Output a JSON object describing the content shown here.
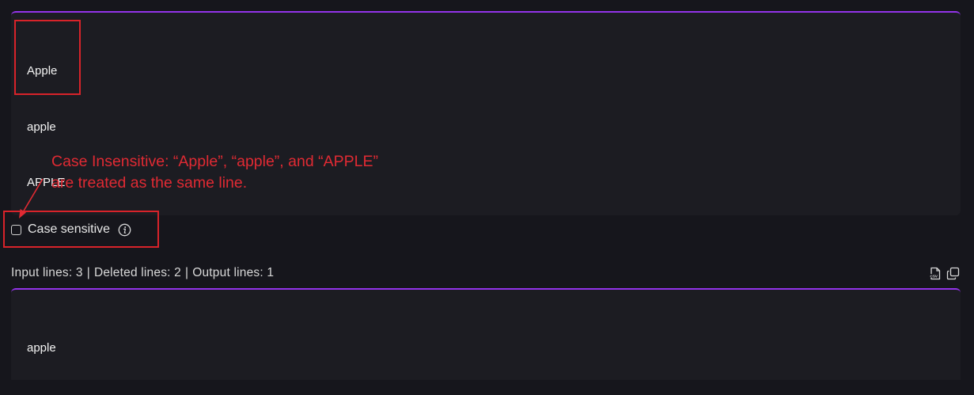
{
  "input": {
    "lines": [
      "Apple",
      "apple",
      "APPLE"
    ]
  },
  "annotation": {
    "line1": "Case Insensitive: “Apple”, “apple”, and “APPLE”",
    "line2": "are treated as the same line."
  },
  "options": {
    "case_sensitive_label": "Case sensitive",
    "case_sensitive_checked": false
  },
  "stats": {
    "input_lines": "Input lines: 3",
    "deleted_lines": "Deleted lines: 2",
    "output_lines": "Output lines: 1",
    "separator": "|"
  },
  "output": {
    "lines": [
      "apple"
    ]
  },
  "icons": {
    "export": "csv-file-icon",
    "copy": "copy-icon",
    "info": "info-icon"
  },
  "colors": {
    "accent": "#9333ea",
    "annotation_red": "#e02a33",
    "background": "#16161c",
    "panel": "#1c1c22"
  }
}
